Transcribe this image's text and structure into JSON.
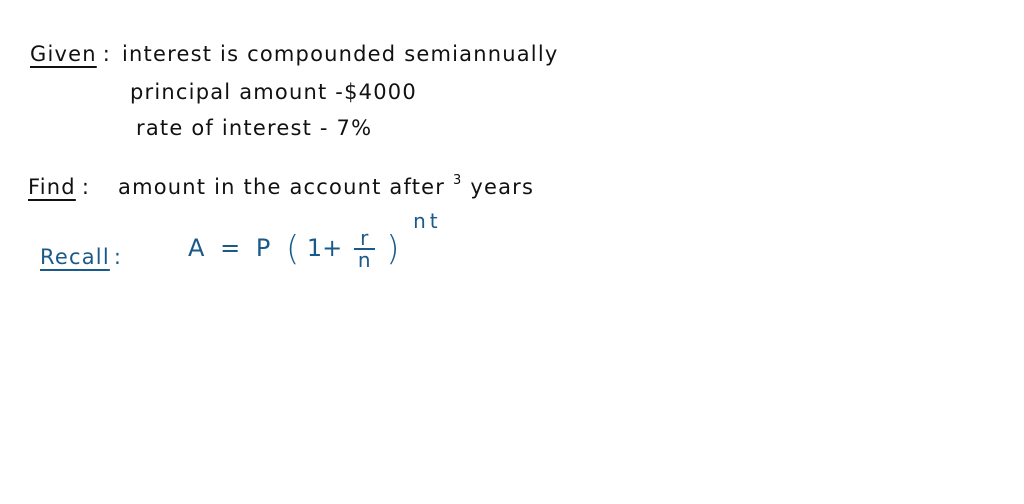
{
  "given": {
    "label": "Given",
    "colon": ":",
    "lines": [
      "interest is compounded   semiannually",
      "principal amount -$4000",
      "rate of interest  -  7%"
    ]
  },
  "find": {
    "label": "Find",
    "colon": ":",
    "text_before": "amount in the account after",
    "years_number": "3",
    "text_after": "years"
  },
  "recall": {
    "label": "Recall",
    "colon": ":",
    "formula": {
      "lhs": "A",
      "equals": "=",
      "principal": "P",
      "open_paren": "(",
      "one_plus": "1+",
      "numerator": "r",
      "denominator": "n",
      "close_paren": ")",
      "exponent": "nt"
    }
  },
  "colors": {
    "ink": "#111111",
    "recall_ink": "#1a5a8a",
    "background": "#ffffff"
  }
}
